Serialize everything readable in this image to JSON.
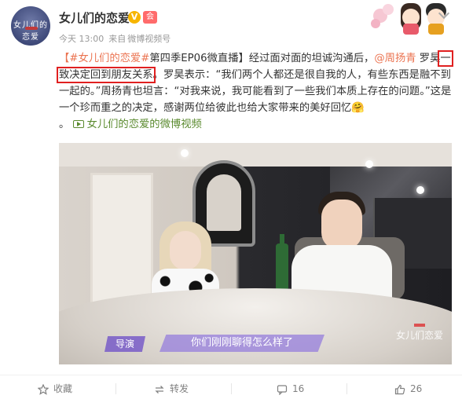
{
  "account": {
    "name": "女儿们的恋爱",
    "avatar_text": "女儿们的恋爱",
    "verified_badge": "V",
    "member_badge": "会",
    "time": "今天 13:00",
    "source_prefix": "来自",
    "source": "微博视频号"
  },
  "post": {
    "tag1": "【#女儿们的恋爱#",
    "text1": "第四季EP06微直播】经过面对面的坦诚沟通后，",
    "mention": "@周扬青",
    "text2": " 罗昊",
    "highlight": "一致决定回到朋友关系",
    "text3": "。罗昊表示：“我们两个人都还是很自我的人，有些东西是融不到一起的。”周扬青也坦言：“对我来说，我可能看到了一些我们本质上存在的问题。”这是一个珍而重之的决定，感谢两位给彼此也给大家带来的美好回忆🤗",
    "text4": "。",
    "video_link": "女儿们的恋爱的微博视频"
  },
  "video": {
    "speaker_label": "导演",
    "subtitle": "你们刚刚聊得怎么样了",
    "watermark": "女儿们恋爱"
  },
  "actions": {
    "favorite": "收藏",
    "repost": "转发",
    "comments": "16",
    "likes": "26"
  },
  "icons": {
    "favorite": "star-icon",
    "repost": "repost-icon",
    "comment": "comment-icon",
    "like": "thumbs-up-icon"
  },
  "colors": {
    "link": "#eb7350",
    "video_link": "#5a8a2e",
    "highlight_box": "#e02020",
    "verified": "#f7b500"
  }
}
